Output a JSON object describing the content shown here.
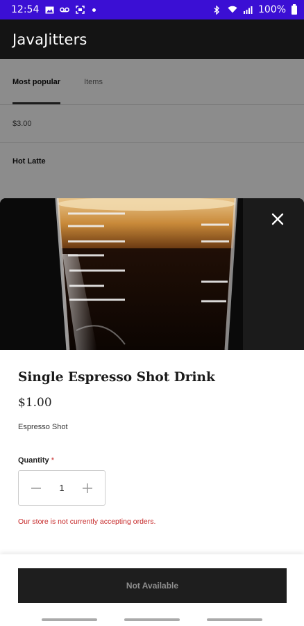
{
  "status_bar": {
    "time": "12:54",
    "battery": "100%",
    "icons": [
      "image-icon",
      "voicemail-icon",
      "screenshot-icon",
      "bluetooth-icon",
      "wifi-icon",
      "signal-icon",
      "battery-icon"
    ]
  },
  "app": {
    "title": "JavaJitters"
  },
  "tabs": [
    {
      "label": "Most popular",
      "active": true
    },
    {
      "label": "Items",
      "active": false
    }
  ],
  "background_list": {
    "price": "$3.00",
    "name": "Hot Latte"
  },
  "modal": {
    "title": "Single Espresso Shot Drink",
    "price": "$1.00",
    "description": "Espresso Shot",
    "quantity_label": "Quantity",
    "required_marker": "*",
    "quantity_value": "1",
    "error": "Our store is not currently accepting orders.",
    "button_label": "Not Available"
  },
  "colors": {
    "status_bar": "#3b0fd4",
    "app_bar": "#141414",
    "error": "#c62828",
    "button_bg": "#1e1e1e"
  }
}
